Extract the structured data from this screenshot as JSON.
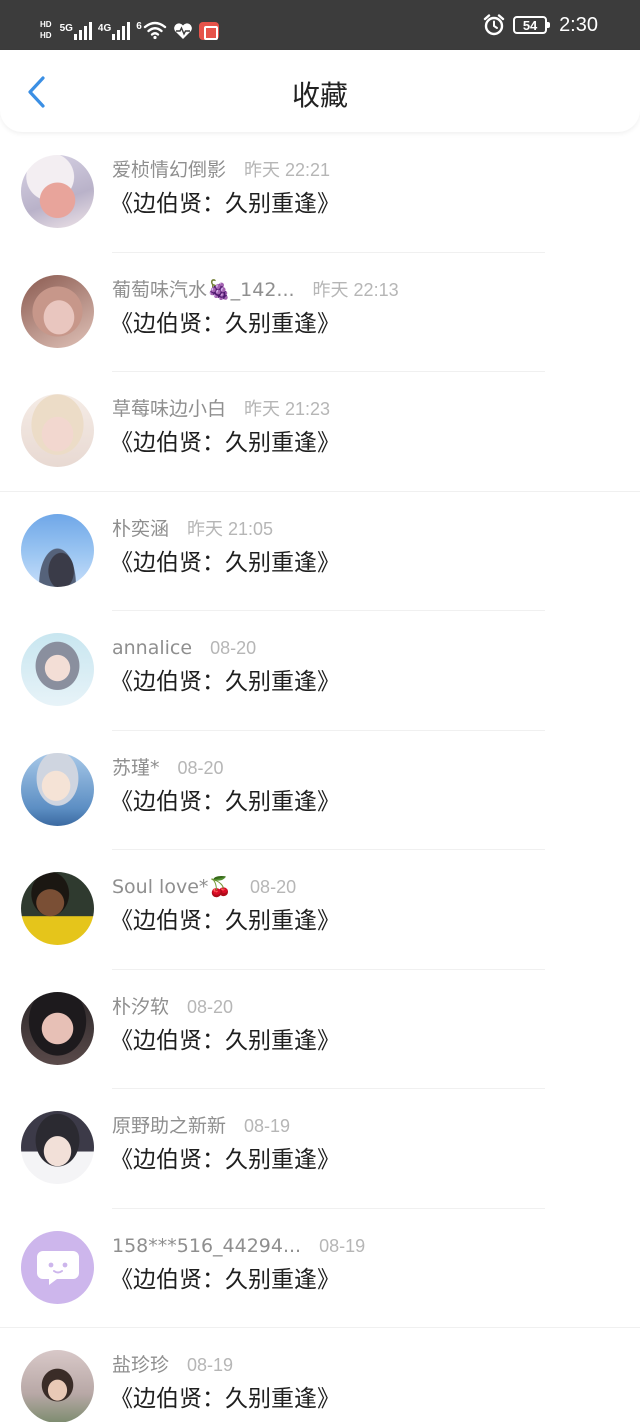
{
  "status_bar": {
    "hd1": "HD",
    "hd2": "HD",
    "net1": "5G",
    "net2": "4G",
    "wifi_badge": "6",
    "battery": "54",
    "time": "2:30"
  },
  "header": {
    "title": "收藏",
    "back_icon": "chevron-left-icon"
  },
  "items": [
    {
      "name": "爱桢情幻倒影",
      "time": "昨天 22:21",
      "title": "《边伯贤：久别重逢》"
    },
    {
      "name": "葡萄味汽水🍇_142...",
      "time": "昨天 22:13",
      "title": "《边伯贤：久别重逢》"
    },
    {
      "name": "草莓味边小白",
      "time": "昨天 21:23",
      "title": "《边伯贤：久别重逢》"
    },
    {
      "name": "朴奕涵",
      "time": "昨天 21:05",
      "title": "《边伯贤：久别重逢》"
    },
    {
      "name": "annalice",
      "time": "08-20",
      "title": "《边伯贤：久别重逢》"
    },
    {
      "name": "苏瑾*",
      "time": "08-20",
      "title": "《边伯贤：久别重逢》"
    },
    {
      "name": "Soul love*🍒",
      "time": "08-20",
      "title": "《边伯贤：久别重逢》"
    },
    {
      "name": "朴汐软",
      "time": "08-20",
      "title": "《边伯贤：久别重逢》"
    },
    {
      "name": "原野助之新新",
      "time": "08-19",
      "title": "《边伯贤：久别重逢》"
    },
    {
      "name": "158***516_44294...",
      "time": "08-19",
      "title": "《边伯贤：久别重逢》"
    },
    {
      "name": "盐珍珍",
      "time": "08-19",
      "title": "《边伯贤：久别重逢》"
    }
  ]
}
